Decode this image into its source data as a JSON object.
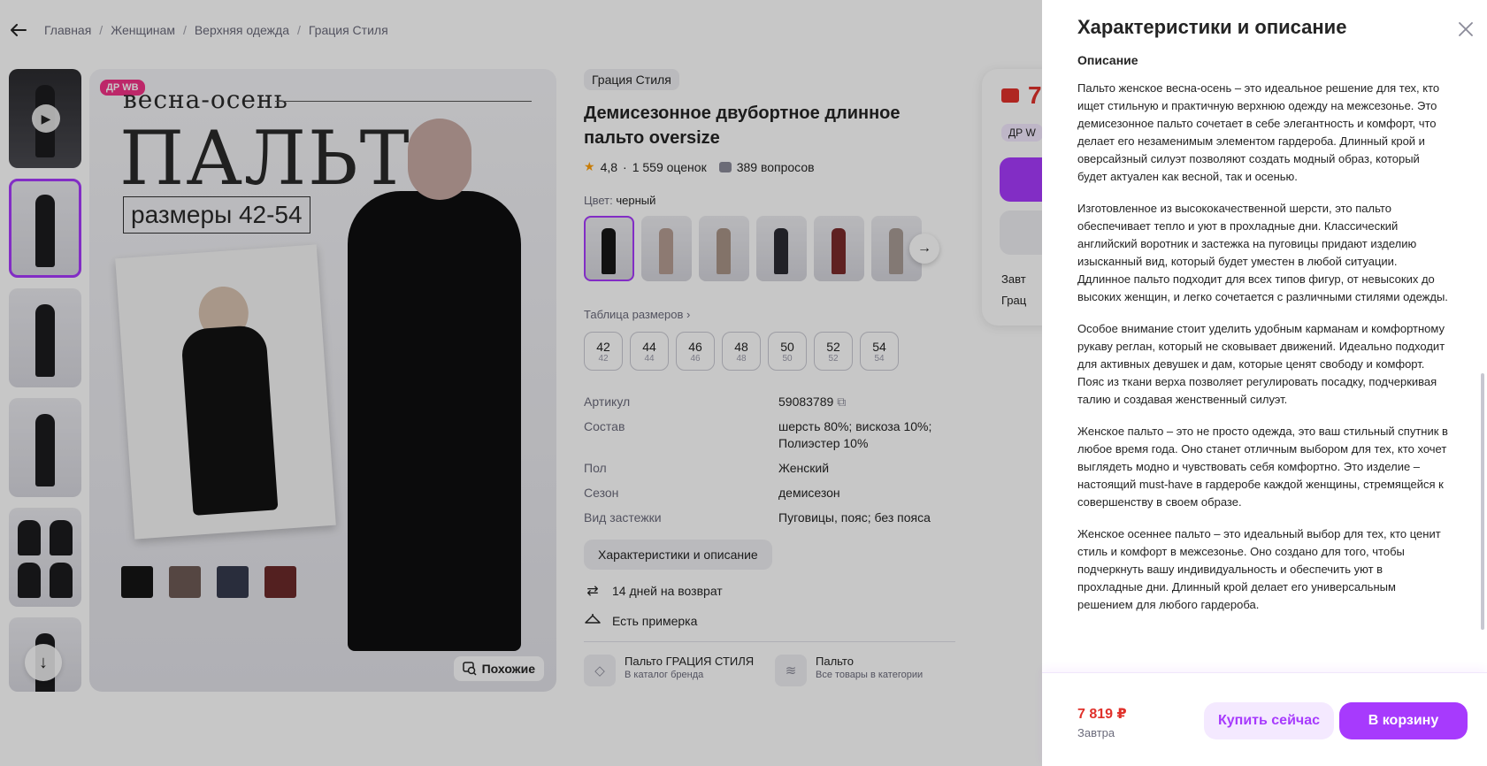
{
  "breadcrumb": {
    "items": [
      "Главная",
      "Женщинам",
      "Верхняя одежда",
      "Грация Стиля"
    ]
  },
  "gallery": {
    "badge": "ДР WB",
    "photo_text": {
      "season": "весна-осень",
      "title": "ПАЛЬТО",
      "sizes": "размеры 42-54"
    },
    "similar_label": "Похожие",
    "swatch_colors": [
      "#151515",
      "#6d5a55",
      "#353a4d",
      "#6b2a2a"
    ]
  },
  "product": {
    "brand": "Грация Стиля",
    "title": "Демисезонное двубортное длинное пальто oversize",
    "rating": "4,8",
    "reviews": "1 559 оценок",
    "questions": "389 вопросов",
    "color_label": "Цвет:",
    "color_value": "черный",
    "variant_colors": [
      "#161616",
      "#b59d92",
      "#a89487",
      "#2b2b33",
      "#7a2b2b",
      "#a89c95"
    ],
    "size_table_label": "Таблица размеров",
    "sizes": [
      {
        "main": "42",
        "sub": "42"
      },
      {
        "main": "44",
        "sub": "44"
      },
      {
        "main": "46",
        "sub": "46"
      },
      {
        "main": "48",
        "sub": "48"
      },
      {
        "main": "50",
        "sub": "50"
      },
      {
        "main": "52",
        "sub": "52"
      },
      {
        "main": "54",
        "sub": "54"
      }
    ],
    "specs": [
      {
        "k": "Артикул",
        "v": "59083789"
      },
      {
        "k": "Состав",
        "v": "шерсть 80%; вискоза 10%; Полиэстер 10%"
      },
      {
        "k": "Пол",
        "v": "Женский"
      },
      {
        "k": "Сезон",
        "v": "демисезон"
      },
      {
        "k": "Вид застежки",
        "v": "Пуговицы, пояс; без пояса"
      }
    ],
    "char_button": "Характеристики и описание",
    "return_text": "14 дней на возврат",
    "fitting_text": "Есть примерка",
    "categories": [
      {
        "title": "Пальто ГРАЦИЯ СТИЛЯ",
        "sub": "В каталог бренда"
      },
      {
        "title": "Пальто",
        "sub": "Все товары в категории"
      }
    ]
  },
  "buybox": {
    "price_partial": "7",
    "badge_partial": "ДР W",
    "row1_partial": "Завт",
    "row2_partial": "Грац"
  },
  "drawer": {
    "title": "Характеристики и описание",
    "section": "Описание",
    "paragraphs": [
      "Пальто женское весна-осень – это идеальное решение для тех, кто ищет стильную и практичную верхнюю одежду на межсезонье. Это демисезонное пальто сочетает в себе элегантность и комфорт, что делает его незаменимым элементом гардероба. Длинный крой и оверсайзный силуэт позволяют создать модный образ, который будет актуален как весной, так и осенью.",
      "Изготовленное из высококачественной шерсти, это пальто обеспечивает тепло и уют в прохладные дни. Классический английский воротник и застежка на пуговицы придают изделию изысканный вид, который будет уместен в любой ситуации. Ддлинное пальто подходит для всех типов фигур, от невысоких до высоких женщин, и легко сочетается с различными стилями одежды.",
      "Особое внимание стоит уделить удобным карманам и комфортному рукаву реглан, который не сковывает движений. Идеально подходит для активных девушек и дам, которые ценят свободу и комфорт. Пояс из ткани верха позволяет регулировать посадку, подчеркивая талию и создавая женственный силуэт.",
      "Женское пальто – это не просто одежда, это ваш стильный спутник в любое время года. Оно станет отличным выбором для тех, кто хочет выглядеть модно и чувствовать себя комфортно. Это изделие – настоящий must-have в гардеробе каждой женщины, стремящейся к совершенству в своем образе.",
      "Женское осеннее пальто – это идеальный выбор для тех, кто ценит стиль и комфорт в межсезонье. Оно создано для того, чтобы подчеркнуть вашу индивидуальность и обеспечить уют в прохладные дни. Длинный крой делает его универсальным решением для любого гардероба."
    ],
    "footer": {
      "price": "7 819 ₽",
      "delivery": "Завтра",
      "buy_now": "Купить сейчас",
      "add_to_cart": "В корзину"
    }
  },
  "colors": {
    "accent": "#a73afd",
    "price": "#e0312b",
    "badge": "#f23287"
  }
}
